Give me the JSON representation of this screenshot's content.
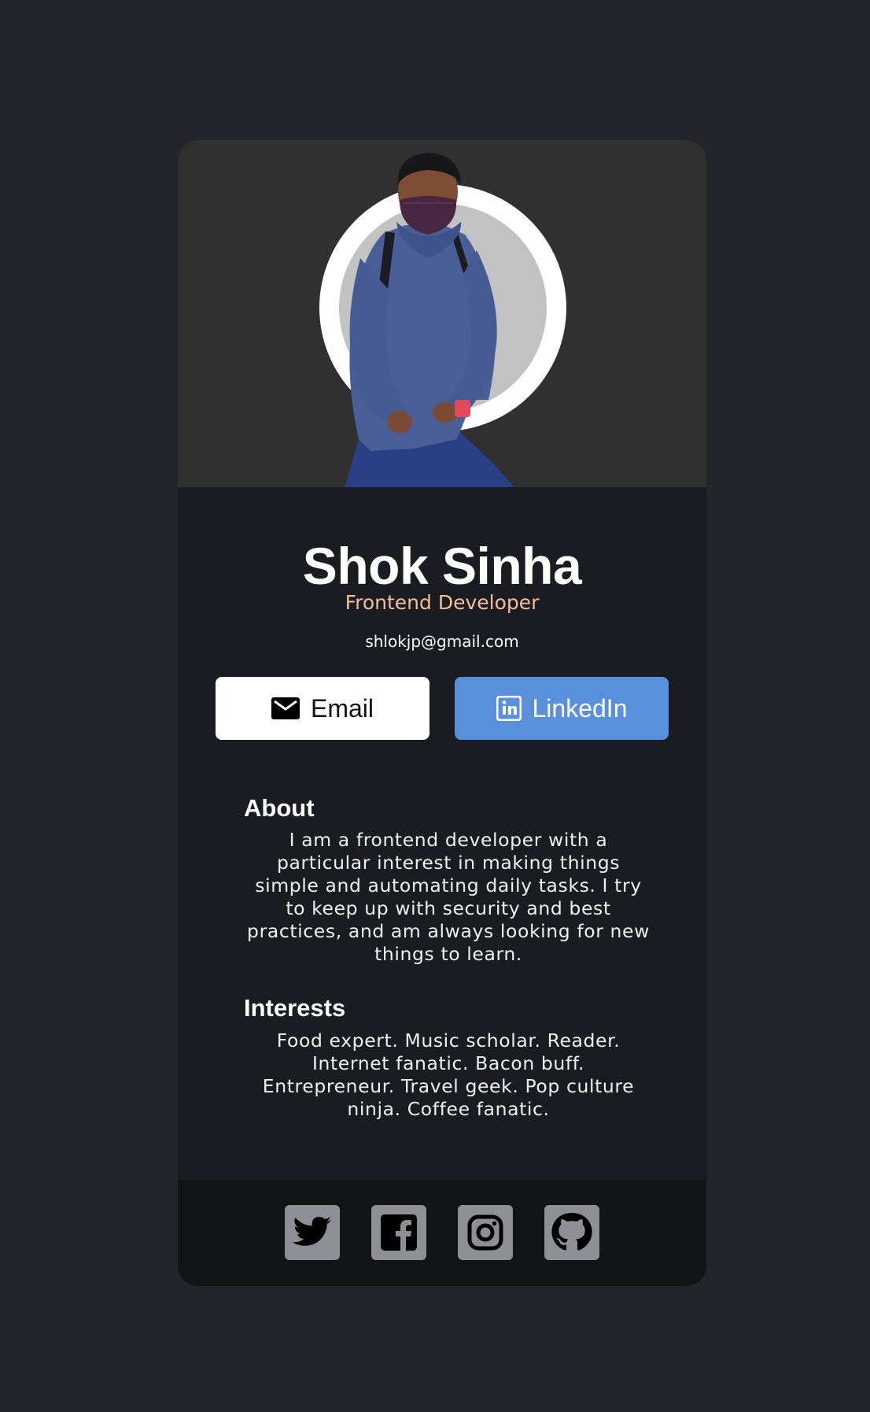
{
  "profile": {
    "name": "Shok Sinha",
    "role": "Frontend Developer",
    "email": "shlokjp@gmail.com",
    "photo_icon": "person-photo"
  },
  "buttons": {
    "email_label": "Email",
    "linkedin_label": "LinkedIn",
    "email_icon": "envelope-icon",
    "linkedin_icon": "linkedin-icon"
  },
  "about": {
    "title": "About",
    "text": "I am a frontend developer with a particular interest in making things simple and automating daily tasks. I try to keep up with security and best practices, and am always looking for new things to learn."
  },
  "interests": {
    "title": "Interests",
    "text": "Food expert. Music scholar. Reader. Internet fanatic. Bacon buff. Entrepreneur. Travel geek. Pop culture ninja. Coffee fanatic."
  },
  "social": {
    "icons": [
      "twitter-icon",
      "facebook-icon",
      "instagram-icon",
      "github-icon"
    ]
  },
  "colors": {
    "page_bg": "#23252b",
    "card_bg": "#1b1c21",
    "hero_bg": "#303030",
    "footer_bg": "#131416",
    "accent_role": "#f3bf99",
    "linkedin_blue": "#5a8fdc",
    "social_tile": "#8e8f95"
  }
}
